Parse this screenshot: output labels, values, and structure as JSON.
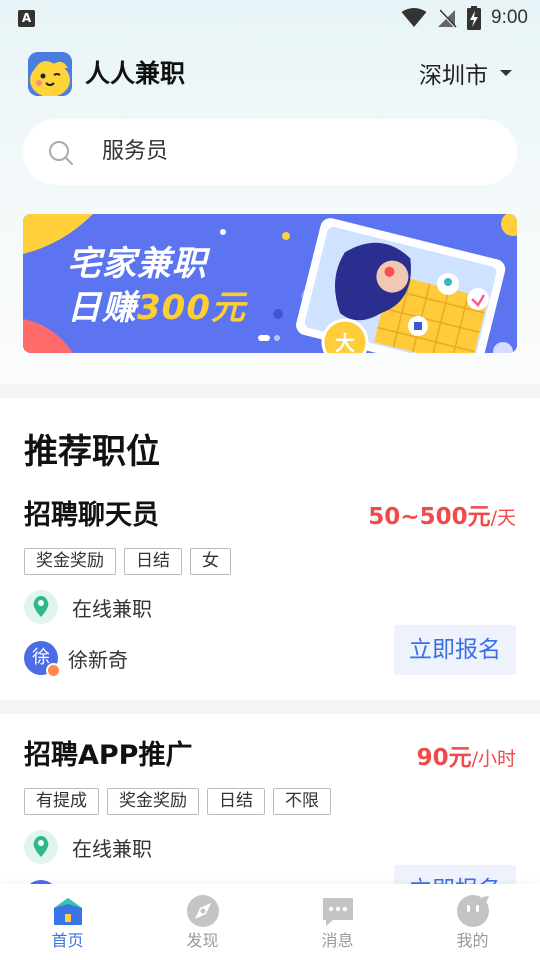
{
  "status_bar": {
    "time": "9:00",
    "left_badge": "A"
  },
  "header": {
    "app_name": "人人兼职",
    "city": "深圳市"
  },
  "search": {
    "text": "服务员"
  },
  "banner": {
    "line1": "宅家兼职",
    "line2_prefix": "日赚",
    "line2_highlight": "300元",
    "active_dot": 1,
    "dot_count": 2
  },
  "section": {
    "title": "推荐职位"
  },
  "jobs": [
    {
      "title": "招聘聊天员",
      "pay": "50~500元",
      "pay_unit": "/天",
      "tags": [
        "奖金奖励",
        "日结",
        "女"
      ],
      "location": "在线兼职",
      "avatar_char": "徐",
      "poster": "徐新奇",
      "apply_label": "立即报名"
    },
    {
      "title": "招聘APP推广",
      "pay": "90元",
      "pay_unit": "/小时",
      "tags": [
        "有提成",
        "奖金奖励",
        "日结",
        "不限"
      ],
      "location": "在线兼职",
      "apply_label": "立即报名"
    }
  ],
  "bottom_nav": [
    {
      "label": "首页",
      "icon": "home-icon",
      "active": true
    },
    {
      "label": "发现",
      "icon": "compass-icon",
      "active": false
    },
    {
      "label": "消息",
      "icon": "message-icon",
      "active": false
    },
    {
      "label": "我的",
      "icon": "profile-icon",
      "active": false
    }
  ],
  "colors": {
    "accent": "#3a74e8",
    "price": "#f04a4a",
    "banner": "#5c74f0",
    "highlight": "#ffcf2e"
  }
}
